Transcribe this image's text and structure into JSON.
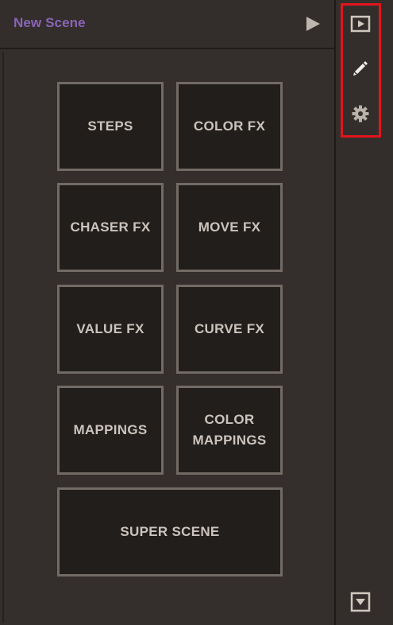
{
  "header": {
    "scene_title": "New Scene",
    "play_icon": "play-icon"
  },
  "buttons": [
    {
      "id": "steps",
      "lines": [
        "STEPS"
      ]
    },
    {
      "id": "color-fx",
      "lines": [
        "COLOR FX"
      ]
    },
    {
      "id": "chaser-fx",
      "lines": [
        "CHASER FX"
      ]
    },
    {
      "id": "move-fx",
      "lines": [
        "MOVE FX"
      ]
    },
    {
      "id": "value-fx",
      "lines": [
        "VALUE FX"
      ]
    },
    {
      "id": "curve-fx",
      "lines": [
        "CURVE FX"
      ]
    },
    {
      "id": "mappings",
      "lines": [
        "MAPPINGS"
      ]
    },
    {
      "id": "color-mappings",
      "lines": [
        "COLOR",
        "MAPPINGS"
      ]
    },
    {
      "id": "super-scene",
      "lines": [
        "SUPER SCENE"
      ]
    }
  ],
  "sidebar": {
    "icons": [
      "play-box-icon",
      "pencil-icon",
      "gear-icon"
    ],
    "bottom_icon": "dropdown-box-icon",
    "highlight_color": "#e2141c"
  },
  "colors": {
    "title": "#8a64b8",
    "button_bg": "#221e1c",
    "button_border": "#726a64",
    "button_text": "#cbc4bd",
    "panel_bg": "#342f2c"
  }
}
